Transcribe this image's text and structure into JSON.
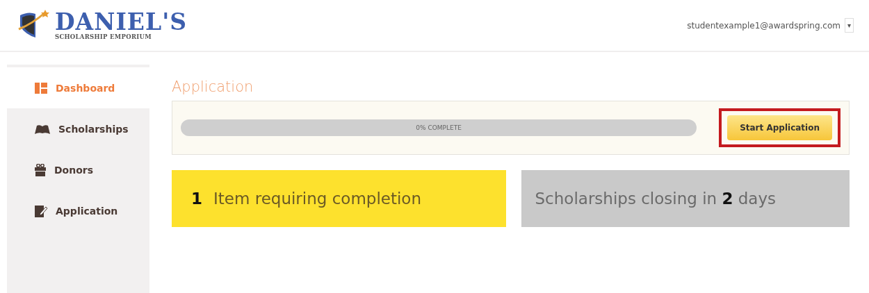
{
  "logo": {
    "title": "DANIEL'S",
    "subtitle": "SCHOLARSHIP EMPORIUM"
  },
  "user_menu": {
    "email": "studentexample1@awardspring.com",
    "caret": "▾"
  },
  "sidebar": {
    "items": [
      {
        "label": "Dashboard",
        "kind": "dashboard",
        "selected": true
      },
      {
        "label": "Scholarships",
        "kind": "book",
        "selected": false
      },
      {
        "label": "Donors",
        "kind": "gift",
        "selected": false
      },
      {
        "label": "Application",
        "kind": "edit",
        "selected": false
      }
    ]
  },
  "application": {
    "heading": "Application",
    "progress": {
      "label": "0% COMPLETE"
    },
    "button": {
      "label": "Start Application",
      "highlighted": true
    }
  },
  "cards": [
    {
      "kind": "count",
      "number": "1",
      "text": "Item requiring completion"
    },
    {
      "kind": "notice",
      "text": "Scholarships closing in **2** days"
    }
  ]
}
